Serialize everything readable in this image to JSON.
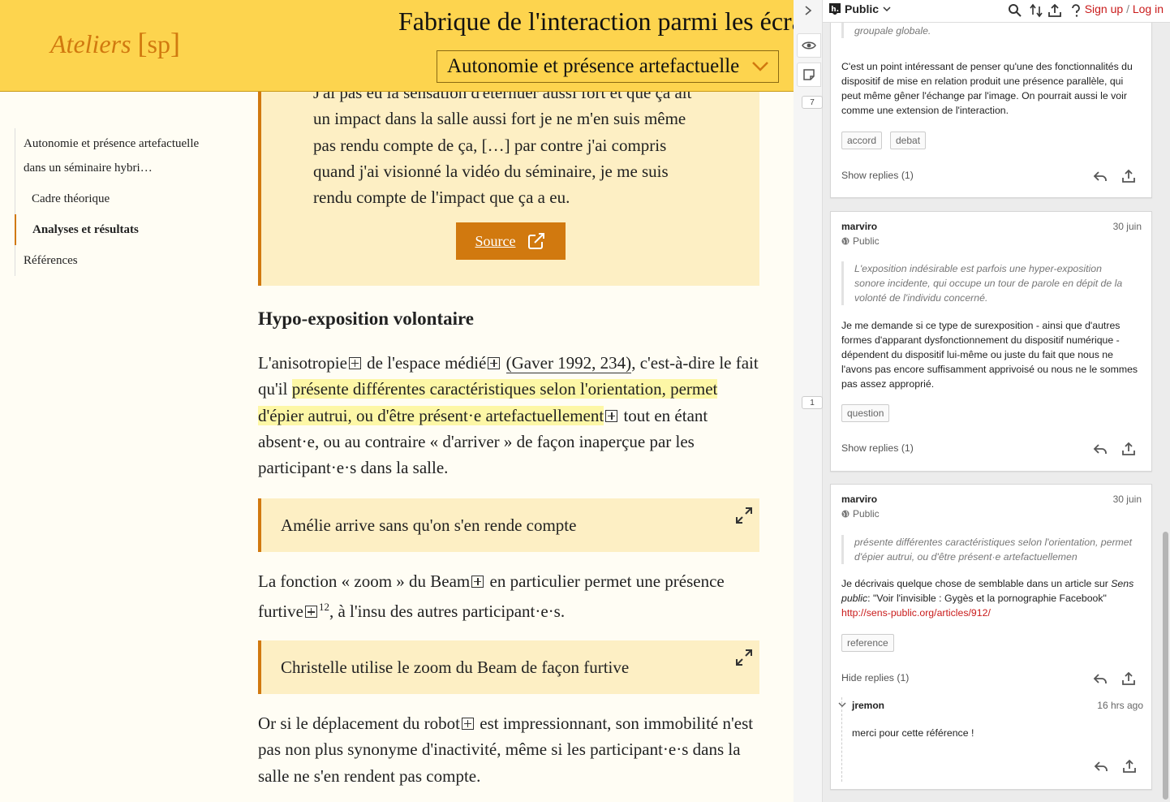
{
  "header": {
    "logo_main": "Ateliers",
    "logo_bracket_open": "[",
    "logo_bracket_text": "sp",
    "logo_bracket_close": "]",
    "doc_title": "Fabrique de l'interaction parmi les écran",
    "section_selected": "Autonomie et présence artefactuelle"
  },
  "toc": {
    "items": [
      {
        "label": "Autonomie et présence artefactuelle"
      },
      {
        "label": "dans un séminaire hybri…"
      },
      {
        "label": "Cadre théorique"
      },
      {
        "label": "Analyses et résultats"
      },
      {
        "label": "Références"
      }
    ]
  },
  "main": {
    "quote_lines": [
      "J'ai pas eu la sensation d'éternuer aussi fort et que ça ait",
      "un impact dans la salle aussi fort je ne m'en suis même",
      "pas rendu compte de ça, […] par contre j'ai compris",
      "quand j'ai visionné la vidéo du séminaire, je me suis",
      "rendu compte de l'impact que ça a eu."
    ],
    "source_label": "Source",
    "heading": "Hypo-exposition volontaire",
    "para1": {
      "t1": "L'anisotropie",
      "t2": " de l'espace médié",
      "cite": "(Gaver 1992, 234)",
      "t3": ", c'est-à-dire le fait qu'il ",
      "highlight": "présente différentes caractéristiques selon l'orientation, permet d'épier autrui, ou d'être présent·e artefactuellement",
      "t4": " tout en étant absent·e, ou au contraire « d'arriver » de façon inaperçue par les participant·e·s dans la salle."
    },
    "media1": "Amélie arrive sans qu'on s'en rende compte",
    "para2": {
      "t1": "La fonction « zoom » du Beam",
      "t2": " en particulier permet une présence furtive",
      "sup": "12",
      "t3": ", à l'insu des autres participant·e·s."
    },
    "media2": "Christelle utilise le zoom du Beam de façon furtive",
    "para3": {
      "t1": "Or si le déplacement du robot",
      "t2": " est impressionnant, son immobilité n'est pas non plus synonyme d'inactivité, même si les participant·e·s dans la salle ne s'en rendent pas compte."
    }
  },
  "sidebar": {
    "bucket_top": "7",
    "bucket_mid": "1"
  },
  "panel": {
    "group": "Public",
    "signup": "Sign up",
    "sep": "/",
    "login": "Log in",
    "card1": {
      "quote_partial": "les participant·e·s ne cherchent plus le relais vers l'interaction groupale globale.",
      "body": "C'est un point intéressant de penser qu'une des fonctionnalités du dispositif de mise en relation produit une présence parallèle, qui peut même gêner l'échange par l'image. On pourrait aussi le voir comme une extension de l'interaction.",
      "tags": [
        "accord",
        "debat"
      ],
      "replies": "Show replies (1)"
    },
    "card2": {
      "user": "marviro",
      "date": "30 juin",
      "privacy": "Public",
      "quote": "L'exposition indésirable est parfois une hyper-exposition sonore incidente, qui occupe un tour de parole en dépit de la volonté de l'individu concerné.",
      "body": "Je me demande si ce type de surexposition - ainsi que d'autres formes d'apparant dysfonctionnement du dispositif numérique - dépendent du dispositif lui-même ou juste du fait que nous ne l'avons pas encore suffisamment apprivoisé ou nous ne le sommes pas assez approprié.",
      "tags": [
        "question"
      ],
      "replies": "Show replies (1)"
    },
    "card3": {
      "user": "marviro",
      "date": "30 juin",
      "privacy": "Public",
      "quote": "présente différentes caractéristiques selon l'orientation, permet d'épier autrui, ou d'être présent·e artefactuellemen",
      "body_pre": "Je décrivais quelque chose de semblable dans un article sur ",
      "body_em": "Sens public",
      "body_mid": ": \"Voir l'invisible : Gygès et la pornographie Facebook\" ",
      "body_link": "http://sens-public.org/articles/912/",
      "tags": [
        "reference"
      ],
      "replies": "Hide replies (1)",
      "reply": {
        "user": "jremon",
        "date": "16 hrs ago",
        "body": "merci pour cette référence !"
      }
    }
  },
  "colors": {
    "header_bg": "#fdd44e",
    "accent": "#d1790f",
    "quote_bg": "#fdefc4",
    "highlight": "#fdf7a6",
    "link": "#c91b1b"
  }
}
